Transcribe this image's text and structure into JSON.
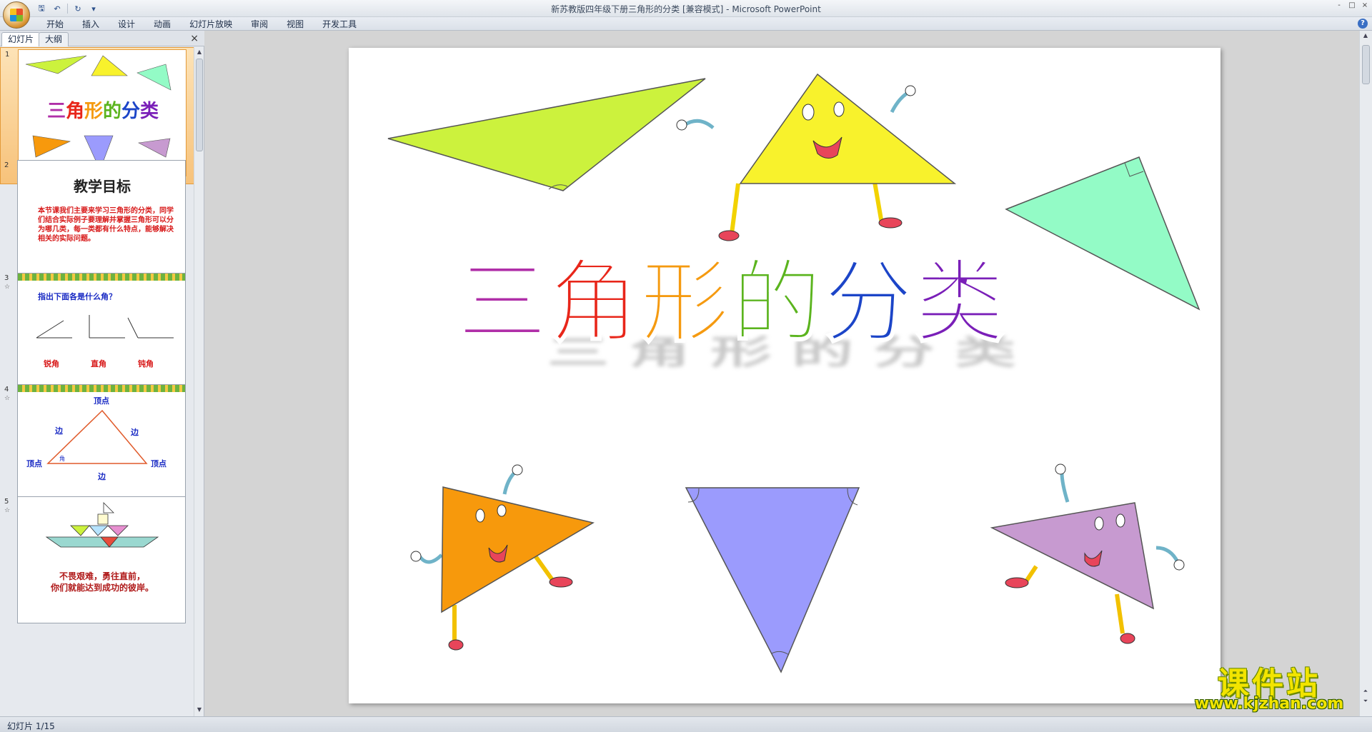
{
  "window": {
    "title": "新苏教版四年级下册三角形的分类 [兼容模式]",
    "app_name": "Microsoft PowerPoint",
    "controls": [
      "-",
      "□",
      "×"
    ]
  },
  "quick_access": [
    "save-icon",
    "undo-icon",
    "redo-icon",
    "customize-icon"
  ],
  "ribbon": {
    "tabs": [
      "开始",
      "插入",
      "设计",
      "动画",
      "幻灯片放映",
      "审阅",
      "视图",
      "开发工具"
    ],
    "help": "?"
  },
  "left_pane": {
    "tabs": [
      "幻灯片",
      "大纲"
    ],
    "close": "×",
    "slides": [
      {
        "number": "1",
        "title": "三角形的分类"
      },
      {
        "number": "2",
        "heading": "教学目标",
        "body": "本节课我们主要来学习三角形的分类，同学们结合实际例子要理解并掌握三角形可以分为哪几类，每一类都有什么特点，能够解决相关的实际问题。"
      },
      {
        "number": "3",
        "question": "指出下面各是什么角？",
        "labels": [
          "锐角",
          "直角",
          "钝角"
        ]
      },
      {
        "number": "4",
        "labels": {
          "top": "顶点",
          "left": "顶点",
          "right": "顶点",
          "side_left": "边",
          "side_right": "边",
          "bottom": "边",
          "angle": "角"
        }
      },
      {
        "number": "5",
        "caption_line1": "不畏艰难，勇往直前，",
        "caption_line2": "你们就能达到成功的彼岸。"
      }
    ]
  },
  "slide": {
    "title_chars": [
      "三",
      "角",
      "形",
      "的",
      "分",
      "类"
    ],
    "title_colors": [
      "#b02fa8",
      "#e8261a",
      "#f59a10",
      "#5bb41e",
      "#1c45c8",
      "#7a1fb8"
    ],
    "shape_colors": {
      "green_obtuse": "#ccf23d",
      "yellow": "#f8f22c",
      "mint": "#93fbc6",
      "orange": "#f7990c",
      "blue": "#9b9bfd",
      "violet": "#c79ad0"
    }
  },
  "status": {
    "slide_counter": "幻灯片 1/15"
  },
  "watermark": {
    "title": "课件站",
    "url": "www.kjzhan.com"
  }
}
